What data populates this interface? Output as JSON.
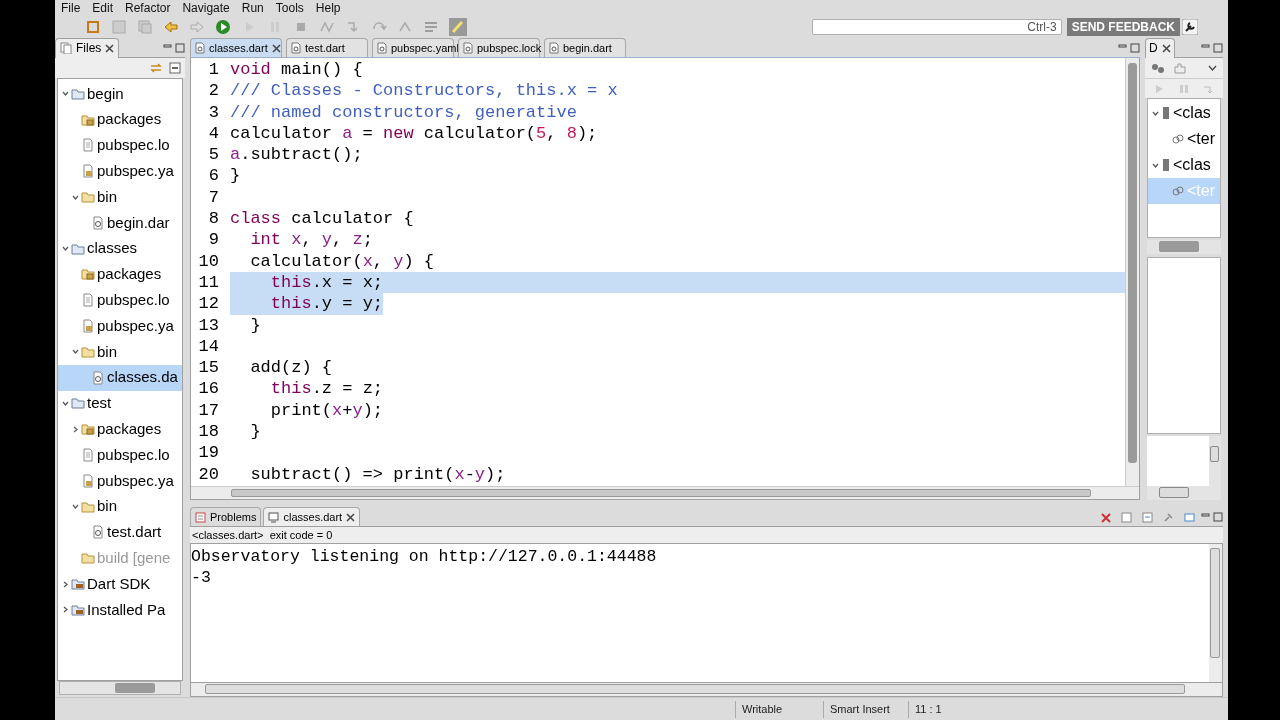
{
  "menu": [
    "File",
    "Edit",
    "Refactor",
    "Navigate",
    "Run",
    "Tools",
    "Help"
  ],
  "quick_access": {
    "placeholder": "Ctrl-3"
  },
  "feedback_button": "SEND FEEDBACK",
  "files_panel": {
    "title": "Files",
    "tree": [
      {
        "label": "begin",
        "kind": "project",
        "expanded": true,
        "selected": false,
        "disabled": false,
        "children": [
          {
            "label": "packages",
            "kind": "packages",
            "selected": false,
            "disabled": false
          },
          {
            "label": "pubspec.lo",
            "kind": "file",
            "selected": false,
            "disabled": false
          },
          {
            "label": "pubspec.ya",
            "kind": "yaml",
            "selected": false,
            "disabled": false
          },
          {
            "label": "bin",
            "kind": "folder",
            "expanded": true,
            "selected": false,
            "disabled": false,
            "children": [
              {
                "label": "begin.dar",
                "kind": "dart",
                "selected": false,
                "disabled": false
              }
            ]
          }
        ]
      },
      {
        "label": "classes",
        "kind": "project",
        "expanded": true,
        "selected": false,
        "disabled": false,
        "children": [
          {
            "label": "packages",
            "kind": "packages",
            "selected": false,
            "disabled": false
          },
          {
            "label": "pubspec.lo",
            "kind": "file",
            "selected": false,
            "disabled": false
          },
          {
            "label": "pubspec.ya",
            "kind": "yaml",
            "selected": false,
            "disabled": false
          },
          {
            "label": "bin",
            "kind": "folder",
            "expanded": true,
            "selected": false,
            "disabled": false,
            "children": [
              {
                "label": "classes.da",
                "kind": "dart",
                "selected": true,
                "disabled": false
              }
            ]
          }
        ]
      },
      {
        "label": "test",
        "kind": "project",
        "expanded": true,
        "selected": false,
        "disabled": false,
        "children": [
          {
            "label": "packages",
            "kind": "packages",
            "expanded": false,
            "selected": false,
            "disabled": false
          },
          {
            "label": "pubspec.lo",
            "kind": "file",
            "selected": false,
            "disabled": false
          },
          {
            "label": "pubspec.ya",
            "kind": "yaml",
            "selected": false,
            "disabled": false
          },
          {
            "label": "bin",
            "kind": "folder",
            "expanded": true,
            "selected": false,
            "disabled": false,
            "children": [
              {
                "label": "test.dart",
                "kind": "dart",
                "selected": false,
                "disabled": false
              }
            ]
          },
          {
            "label": "build [gene",
            "kind": "folder",
            "selected": false,
            "disabled": true
          }
        ]
      },
      {
        "label": "Dart SDK",
        "kind": "library",
        "expanded": false,
        "selected": false,
        "disabled": false
      },
      {
        "label": "Installed Pa",
        "kind": "library",
        "expanded": false,
        "selected": false,
        "disabled": false
      }
    ]
  },
  "editor": {
    "tabs": [
      {
        "label": "classes.dart",
        "selected": true
      },
      {
        "label": "test.dart",
        "selected": false
      },
      {
        "label": "pubspec.yaml",
        "selected": false
      },
      {
        "label": "pubspec.lock",
        "selected": false
      },
      {
        "label": "begin.dart",
        "selected": false
      }
    ],
    "lines": [
      {
        "number": "1",
        "selected": false,
        "segments": [
          {
            "text": "void",
            "kind": "keyword"
          },
          {
            "text": " main() {",
            "kind": "plain"
          }
        ]
      },
      {
        "number": "2",
        "selected": false,
        "segments": [
          {
            "text": "/// Classes - Constructors, this.x = x",
            "kind": "comment"
          }
        ]
      },
      {
        "number": "3",
        "selected": false,
        "segments": [
          {
            "text": "/// named constructors, generative",
            "kind": "comment"
          }
        ]
      },
      {
        "number": "4",
        "selected": false,
        "segments": [
          {
            "text": "calculator ",
            "kind": "plain"
          },
          {
            "text": "a",
            "kind": "field"
          },
          {
            "text": " = ",
            "kind": "plain"
          },
          {
            "text": "new",
            "kind": "keyword"
          },
          {
            "text": " calculator(",
            "kind": "plain"
          },
          {
            "text": "5",
            "kind": "number"
          },
          {
            "text": ", ",
            "kind": "plain"
          },
          {
            "text": "8",
            "kind": "number"
          },
          {
            "text": ");",
            "kind": "plain"
          }
        ]
      },
      {
        "number": "5",
        "selected": false,
        "segments": [
          {
            "text": "a",
            "kind": "field"
          },
          {
            "text": ".subtract();",
            "kind": "plain"
          }
        ]
      },
      {
        "number": "6",
        "selected": false,
        "segments": [
          {
            "text": "}",
            "kind": "plain"
          }
        ]
      },
      {
        "number": "7",
        "selected": false
      },
      {
        "number": "8",
        "selected": false,
        "segments": [
          {
            "text": "class",
            "kind": "keyword"
          },
          {
            "text": " calculator {",
            "kind": "plain"
          }
        ]
      },
      {
        "number": "9",
        "selected": false,
        "segments": [
          {
            "text": "  int ",
            "kind": "keyword"
          },
          {
            "text": "x",
            "kind": "field"
          },
          {
            "text": ", ",
            "kind": "plain"
          },
          {
            "text": "y",
            "kind": "field"
          },
          {
            "text": ", ",
            "kind": "plain"
          },
          {
            "text": "z",
            "kind": "field"
          },
          {
            "text": ";",
            "kind": "plain"
          }
        ]
      },
      {
        "number": "10",
        "selected": false,
        "segments": [
          {
            "text": "  calculator(",
            "kind": "plain"
          },
          {
            "text": "x",
            "kind": "field"
          },
          {
            "text": ", ",
            "kind": "plain"
          },
          {
            "text": "y",
            "kind": "field"
          },
          {
            "text": ") {",
            "kind": "plain"
          }
        ]
      },
      {
        "number": "11",
        "selected": true,
        "segments": [
          {
            "text": "    this",
            "kind": "keyword"
          },
          {
            "text": ".x = x;",
            "kind": "plain"
          }
        ]
      },
      {
        "number": "12",
        "selected": true,
        "segments": [
          {
            "text": "    this",
            "kind": "keyword"
          },
          {
            "text": ".y = y;",
            "kind": "plain"
          }
        ]
      },
      {
        "number": "13",
        "selected": false,
        "segments": [
          {
            "text": "  }",
            "kind": "plain"
          }
        ]
      },
      {
        "number": "14",
        "selected": false
      },
      {
        "number": "15",
        "selected": false,
        "segments": [
          {
            "text": "  add(z) {",
            "kind": "plain"
          }
        ]
      },
      {
        "number": "16",
        "selected": false,
        "segments": [
          {
            "text": "    this",
            "kind": "keyword"
          },
          {
            "text": ".z = z;",
            "kind": "plain"
          }
        ]
      },
      {
        "number": "17",
        "selected": false,
        "segments": [
          {
            "text": "    print(",
            "kind": "plain"
          },
          {
            "text": "x",
            "kind": "field"
          },
          {
            "text": "+",
            "kind": "plain"
          },
          {
            "text": "y",
            "kind": "field"
          },
          {
            "text": ");",
            "kind": "plain"
          }
        ]
      },
      {
        "number": "18",
        "selected": false,
        "segments": [
          {
            "text": "  }",
            "kind": "plain"
          }
        ]
      },
      {
        "number": "19",
        "selected": false
      },
      {
        "number": "20",
        "selected": false,
        "segments": [
          {
            "text": "  subtract() => print(",
            "kind": "plain"
          },
          {
            "text": "x",
            "kind": "field"
          },
          {
            "text": "-",
            "kind": "plain"
          },
          {
            "text": "y",
            "kind": "field"
          },
          {
            "text": ");",
            "kind": "plain"
          }
        ]
      }
    ]
  },
  "outline_panel": {
    "title": "D",
    "tree": [
      {
        "label": "<clas",
        "expanded": true,
        "selected": false,
        "children": [
          {
            "label": "<ter",
            "selected": false
          }
        ]
      },
      {
        "label": "<clas",
        "expanded": true,
        "selected": false,
        "children": [
          {
            "label": "<ter",
            "selected": true
          }
        ]
      }
    ]
  },
  "console": {
    "tabs": [
      {
        "label": "Problems",
        "selected": false
      },
      {
        "label": "classes.dart",
        "selected": true
      }
    ],
    "header": "<classes.dart>  exit code = 0",
    "output": [
      "Observatory listening on http://127.0.0.1:44488",
      "-3"
    ]
  },
  "status_bar": [
    "Writable",
    "Smart Insert",
    "11 : 1"
  ]
}
